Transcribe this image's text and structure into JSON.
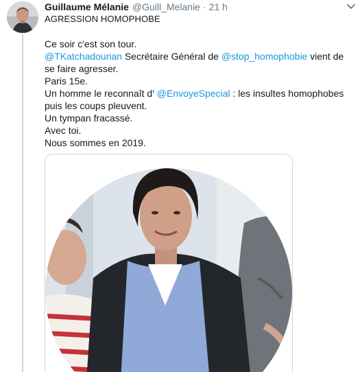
{
  "tweet": {
    "author_name": "Guillaume Mélanie",
    "author_handle": "@Guill_Melanie",
    "separator": "·",
    "timestamp": "21 h",
    "subtitle": "AGRESSION HOMOPHOBE",
    "caret_icon": "chevron-down-icon",
    "lines": {
      "l1": "Ce soir c'est son tour.",
      "l2_mention1": "@TKatchadourian",
      "l2_text1": " Secrétaire Général de ",
      "l2_mention2": "@stop_homophobie",
      "l2_text2": " vient de se faire agresser.",
      "l3": "Paris 15e.",
      "l4_text1": "Un homme le reconnaît d' ",
      "l4_mention": "@EnvoyeSpecial",
      "l4_text2": " : les insultes homophobes puis les coups pleuvent.",
      "l5": "Un tympan fracassé.",
      "l6": "Avec toi.",
      "l7": "Nous sommes en 2019."
    }
  },
  "colors": {
    "link": "#1b95e0",
    "text": "#14171a",
    "secondary": "#657786",
    "border": "#ccd6dd"
  }
}
